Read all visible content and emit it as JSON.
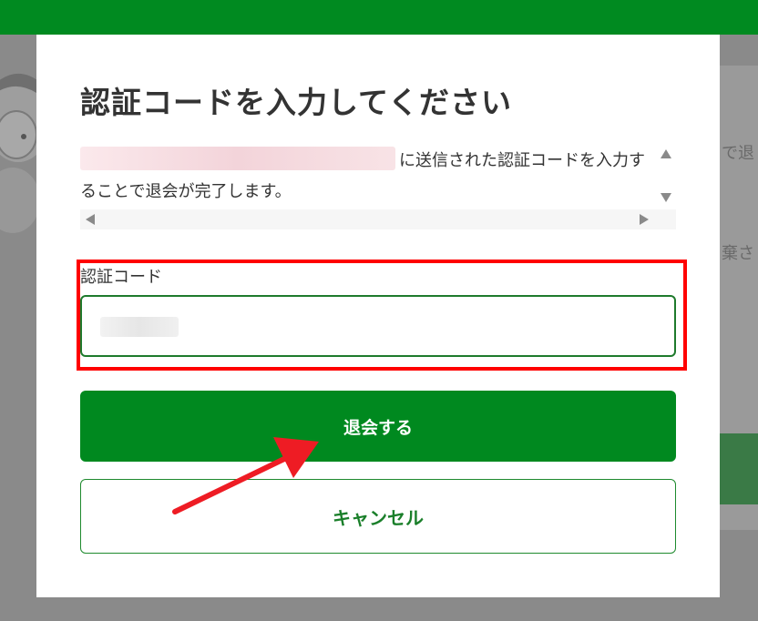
{
  "modal": {
    "title": "認証コードを入力してください",
    "description": "に送信された認証コードを入力することで退会が完了します。",
    "code_label": "認証コード",
    "withdraw_label": "退会する",
    "cancel_label": "キャンセル"
  },
  "background": {
    "right_text_1": "で退",
    "right_text_2": "棄さ"
  },
  "colors": {
    "brand_green": "#008a20",
    "annotation_red": "#ff0000"
  },
  "icons": [
    "scroll-up-icon",
    "scroll-down-icon",
    "scroll-left-icon",
    "scroll-right-icon",
    "annotation-arrow-icon"
  ]
}
